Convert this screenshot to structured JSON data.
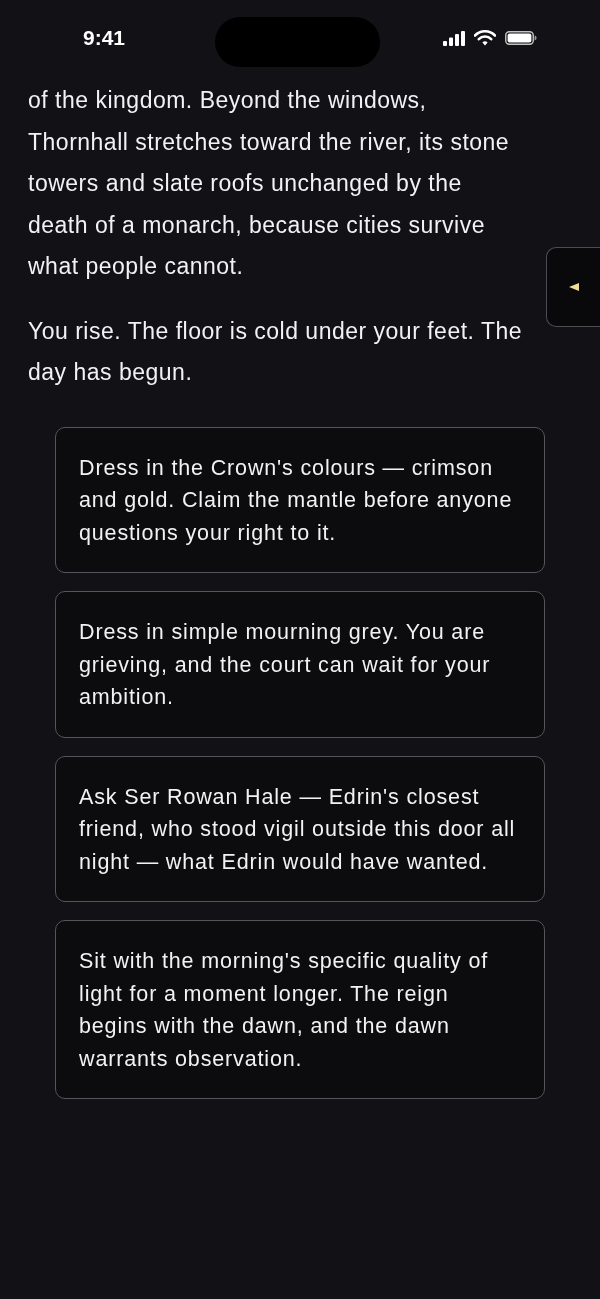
{
  "status_bar": {
    "time": "9:41"
  },
  "story": {
    "paragraphs": [
      "of the kingdom. Beyond the windows, Thornhall stretches toward the river, its stone towers and slate roofs unchanged by the death of a monarch, because cities survive what people cannot.",
      "You rise. The floor is cold under your feet. The day has begun."
    ]
  },
  "choices": [
    {
      "text": "Dress in the Crown's colours — crimson and gold. Claim the mantle before anyone questions your right to it."
    },
    {
      "text": "Dress in simple mourning grey. You are grieving, and the court can wait for your ambition."
    },
    {
      "text": "Ask Ser Rowan Hale — Edrin's closest friend, who stood vigil outside this door all night — what Edrin would have wanted."
    },
    {
      "text": "Sit with the morning's specific quality of light for a moment longer. The reign begins with the dawn, and the dawn warrants observation."
    }
  ]
}
